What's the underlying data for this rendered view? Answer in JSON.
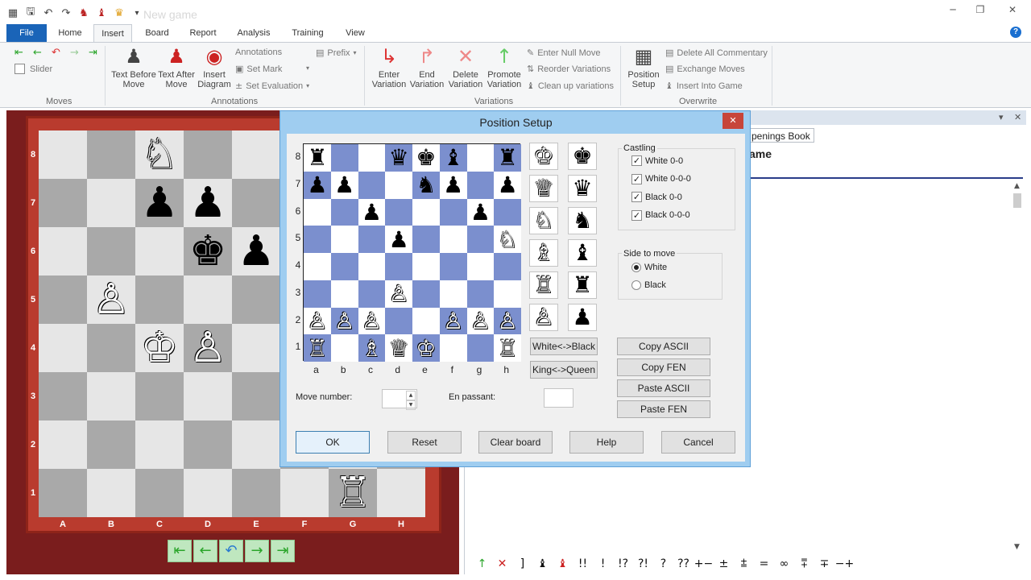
{
  "app": {
    "title": "New game",
    "qat_icons": [
      "chess-logo-icon",
      "save-icon",
      "undo-icon",
      "redo-icon",
      "piece-icon",
      "piece-icon",
      "crown-icon",
      "customize-icon"
    ]
  },
  "ribbon_tabs": [
    "File",
    "Home",
    "Insert",
    "Board",
    "Report",
    "Analysis",
    "Training",
    "View"
  ],
  "active_tab": "Insert",
  "ribbon": {
    "moves": {
      "label": "Moves",
      "slider_label": "Slider"
    },
    "annotations": {
      "label": "Annotations",
      "text_before_move": "Text Before Move",
      "text_after_move": "Text After Move",
      "insert_diagram": "Insert Diagram",
      "annotations": "Annotations",
      "set_mark": "Set Mark",
      "set_evaluation": "Set Evaluation",
      "prefix": "Prefix"
    },
    "variations": {
      "label": "Variations",
      "enter_variation": "Enter Variation",
      "end_variation": "End Variation",
      "delete_variation": "Delete Variation",
      "promote_variation": "Promote Variation",
      "enter_null_move": "Enter Null Move",
      "reorder_variations": "Reorder Variations",
      "clean_up_variations": "Clean up variations"
    },
    "overwrite": {
      "label": "Overwrite",
      "position_setup": "Position Setup",
      "delete_all_commentary": "Delete All Commentary",
      "exchange_moves": "Exchange Moves",
      "insert_into_game": "Insert Into Game"
    }
  },
  "main_board": {
    "files": [
      "A",
      "B",
      "C",
      "D",
      "E",
      "F",
      "G",
      "H"
    ],
    "ranks": [
      "8",
      "7",
      "6",
      "5",
      "4",
      "3",
      "2",
      "1"
    ],
    "rows": [
      [
        "",
        "",
        "♘",
        "",
        "",
        "",
        "",
        ""
      ],
      [
        "",
        "",
        "♟",
        "♟",
        "",
        "",
        "",
        ""
      ],
      [
        "",
        "",
        "",
        "♚",
        "♟",
        "",
        "",
        ""
      ],
      [
        "",
        "♙",
        "",
        "",
        "",
        "",
        "",
        ""
      ],
      [
        "",
        "",
        "♔",
        "♙",
        "",
        "",
        "",
        ""
      ],
      [
        "",
        "",
        "",
        "",
        "",
        "",
        "",
        ""
      ],
      [
        "",
        "",
        "",
        "",
        "",
        "",
        "",
        ""
      ],
      [
        "",
        "",
        "",
        "",
        "",
        "",
        "♖",
        ""
      ]
    ]
  },
  "right_pane": {
    "tab_label": "penings Book",
    "title": "ame"
  },
  "symbol_bar": [
    "↑",
    "✕",
    "]",
    "♝",
    "♝",
    "!!",
    "!",
    "!?",
    "?!",
    "?",
    "??",
    "+−",
    "±",
    "⩲",
    "=",
    "∞",
    "⩱",
    "∓",
    "−+"
  ],
  "dialog": {
    "title": "Position Setup",
    "board": {
      "files": [
        "a",
        "b",
        "c",
        "d",
        "e",
        "f",
        "g",
        "h"
      ],
      "ranks": [
        "8",
        "7",
        "6",
        "5",
        "4",
        "3",
        "2",
        "1"
      ],
      "rows": [
        [
          "♜",
          "",
          "",
          "♛",
          "♚",
          "♝",
          "",
          "♜"
        ],
        [
          "♟",
          "♟",
          "",
          "",
          "♞",
          "♟",
          "",
          "♟"
        ],
        [
          "",
          "",
          "♟",
          "",
          "",
          "",
          "♟",
          ""
        ],
        [
          "",
          "",
          "",
          "♟",
          "",
          "",
          "",
          "♘"
        ],
        [
          "",
          "",
          "",
          "",
          "",
          "",
          "",
          ""
        ],
        [
          "",
          "",
          "",
          "♙",
          "",
          "",
          "",
          ""
        ],
        [
          "♙",
          "♙",
          "♙",
          "",
          "",
          "♙",
          "♙",
          "♙"
        ],
        [
          "♖",
          "",
          "♗",
          "♕",
          "♔",
          "",
          "",
          "♖"
        ]
      ]
    },
    "palette": {
      "white": [
        "♔",
        "♕",
        "♘",
        "♗",
        "♖",
        "♙"
      ],
      "black": [
        "♚",
        "♛",
        "♞",
        "♝",
        "♜",
        "♟"
      ]
    },
    "castling": {
      "legend": "Castling",
      "options": [
        {
          "label": "White 0-0",
          "checked": true
        },
        {
          "label": "White 0-0-0",
          "checked": true
        },
        {
          "label": "Black 0-0",
          "checked": true
        },
        {
          "label": "Black 0-0-0",
          "checked": true
        }
      ]
    },
    "side_to_move": {
      "legend": "Side to move",
      "options": [
        {
          "label": "White",
          "selected": true
        },
        {
          "label": "Black",
          "selected": false
        }
      ]
    },
    "white_black_button": "White<->Black",
    "king_queen_button": "King<->Queen",
    "copy_ascii": "Copy ASCII",
    "copy_fen": "Copy FEN",
    "paste_ascii": "Paste ASCII",
    "paste_fen": "Paste FEN",
    "move_number_label": "Move number:",
    "move_number_value": "",
    "en_passant_label": "En passant:",
    "en_passant_value": "",
    "buttons": {
      "ok": "OK",
      "reset": "Reset",
      "clear_board": "Clear board",
      "help": "Help",
      "cancel": "Cancel"
    }
  }
}
